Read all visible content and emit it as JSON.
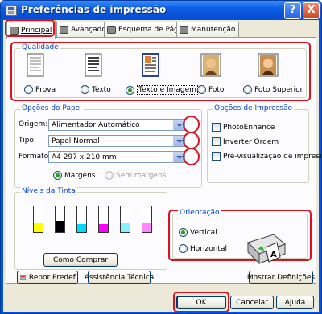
{
  "window": {
    "title": "Preferências de impressão",
    "help_glyph": "?",
    "close_glyph": "X"
  },
  "tabs": [
    {
      "label": "Principal",
      "active": true
    },
    {
      "label": "Avançado"
    },
    {
      "label": "Esquema de Página"
    },
    {
      "label": "Manutenção"
    }
  ],
  "quality": {
    "label": "Qualidade",
    "options": [
      "Prova",
      "Texto",
      "Texto e Imagem",
      "Foto",
      "Foto Superior"
    ],
    "selected": "Texto e Imagem"
  },
  "paper": {
    "label": "Opções do Papel",
    "source_label": "Origem:",
    "source_value": "Alimentador Automático",
    "type_label": "Tipo:",
    "type_value": "Papel Normal",
    "format_label": "Formato:",
    "format_value": "A4 297 x 210 mm",
    "margins_label": "Margens",
    "no_margins_label": "Sem margens"
  },
  "print_options": {
    "label": "Opções de Impressão",
    "photoenhance": "PhotoEnhance",
    "reverse_order": "Inverter Ordem",
    "preview": "Pré-visualização de impressão"
  },
  "ink": {
    "label": "Níveis da Tinta",
    "levels": [
      {
        "color": "#ffff00",
        "level": 0.35
      },
      {
        "color": "#000000",
        "level": 0.45
      },
      {
        "color": "#00d8ff",
        "level": 0.3
      },
      {
        "color": "#ff00ff",
        "level": 0.3
      },
      {
        "color": "#8cf0ff",
        "level": 0.35
      },
      {
        "color": "#ff88ff",
        "level": 0.35
      }
    ],
    "buy_button": "Como Comprar"
  },
  "orientation": {
    "label": "Orientação",
    "vertical": "Vertical",
    "horizontal": "Horizontal",
    "selected": "Vertical"
  },
  "footer_buttons": {
    "reset": "Repor Predef.",
    "support": "Assistência Técnica",
    "show_settings": "Mostrar Definições"
  },
  "dialog_buttons": {
    "ok": "OK",
    "cancel": "Cancelar",
    "help": "Ajuda"
  },
  "colors": {
    "accent_red": "#e0101a",
    "title_blue": "#0054e3",
    "label_blue": "#0046d5"
  }
}
